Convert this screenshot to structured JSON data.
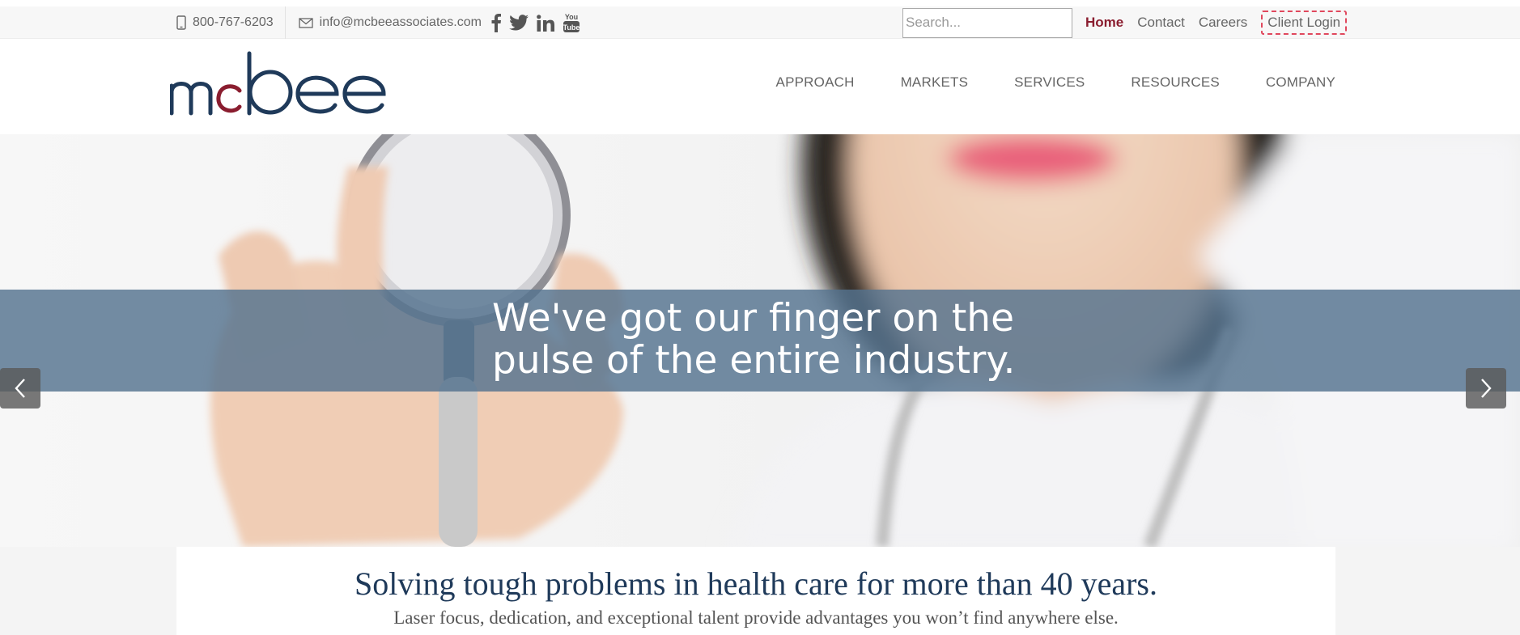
{
  "topbar": {
    "phone": "800-767-6203",
    "email": "info@mcbeeassociates.com",
    "social": [
      {
        "name": "facebook-icon",
        "glyph": "f"
      },
      {
        "name": "twitter-icon",
        "glyph": ""
      },
      {
        "name": "linkedin-icon",
        "glyph": "in"
      },
      {
        "name": "youtube-icon",
        "glyph": "You Tube"
      }
    ],
    "search_placeholder": "Search...",
    "links": {
      "home": "Home",
      "contact": "Contact",
      "careers": "Careers",
      "client_login": "Client Login"
    }
  },
  "header": {
    "logo_text": "mcbee",
    "nav": [
      "APPROACH",
      "MARKETS",
      "SERVICES",
      "RESOURCES",
      "COMPANY"
    ]
  },
  "hero": {
    "headline_line1": "We've got our finger on the",
    "headline_line2": "pulse of the entire industry."
  },
  "intro": {
    "tagline": "Solving tough problems in health care for more than 40 years.",
    "subline": "Laser focus, dedication, and exceptional talent provide advantages you won’t find anywhere else."
  },
  "colors": {
    "brand_navy": "#1f3a5a",
    "brand_red": "#8a1d2f",
    "banner": "#54738f"
  }
}
